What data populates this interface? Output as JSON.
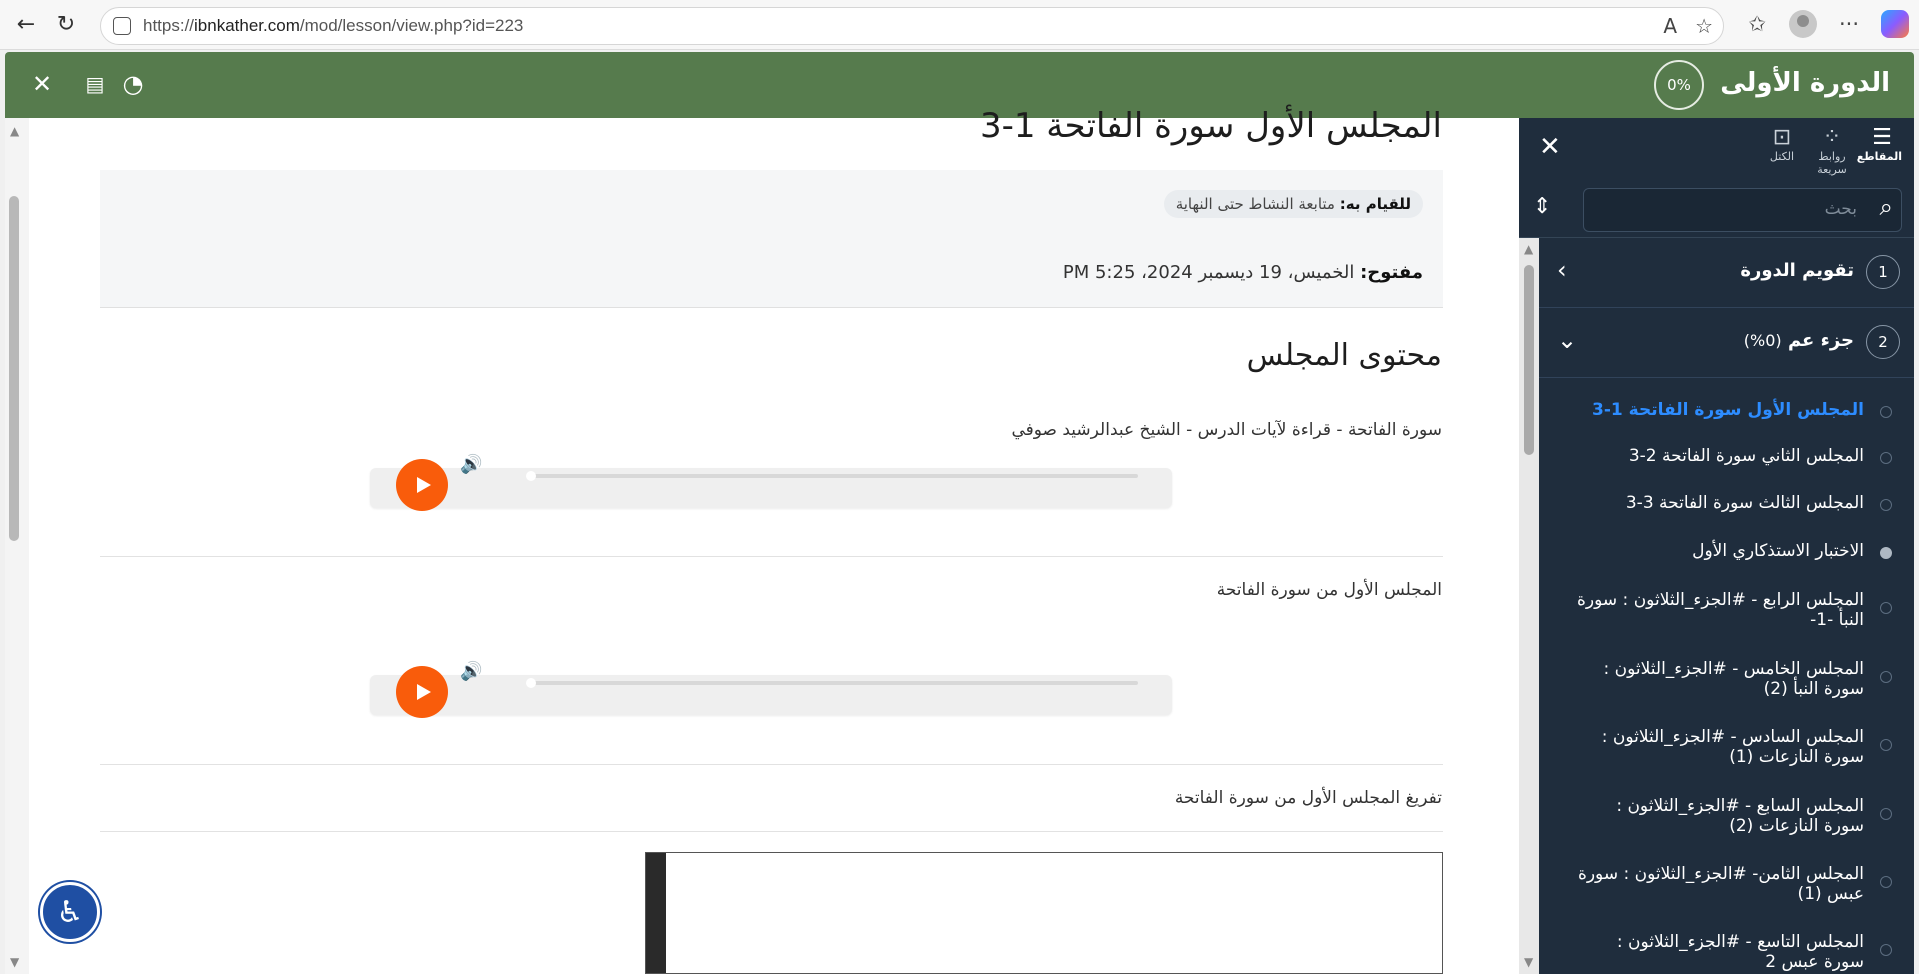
{
  "browser": {
    "url_prefix": "https://",
    "url_domain": "ibnkather.com",
    "url_path": "/mod/lesson/view.php?id=223"
  },
  "course": {
    "title": "الدورة الأولى",
    "progress": "0%"
  },
  "page": {
    "title": "المجلس الأول سورة الفاتحة 1-3",
    "todo_label": "للقيام به:",
    "todo_value": "متابعة النشاط حتى النهاية",
    "opened_label": "مفتوح:",
    "opened_value": "الخميس، 19 ديسمبر 2024، 5:25 PM",
    "content_heading": "محتوى المجلس",
    "audio1_title": "سورة الفاتحة - قراءة لآيات الدرس - الشيخ عبدالرشيد صوفي",
    "audio2_title": "المجلس الأول من سورة الفاتحة",
    "transcript_title": "تفريغ المجلس الأول من سورة الفاتحة"
  },
  "drawer": {
    "tabs": [
      "المقاطع",
      "روابط سريعة",
      "الكتل"
    ],
    "search_placeholder": "بحث",
    "sections": [
      {
        "num": "1",
        "title": "تقويم الدورة",
        "progress": ""
      },
      {
        "num": "2",
        "title": "جزء عم",
        "progress": "(0%)"
      }
    ],
    "lessons": [
      {
        "label": "المجلس الأول سورة الفاتحة 1-3"
      },
      {
        "label": "المجلس الثاني سورة الفاتحة 2-3"
      },
      {
        "label": "المجلس الثالث سورة الفاتحة 3-3"
      },
      {
        "label": "الاختبار الاستذكاري الأول"
      },
      {
        "label": "المجلس الرابع - #الجزء_الثلاثون : سورة النبأ -1-"
      },
      {
        "label": "المجلس الخامس - #الجزء_الثلاثون : سورة النبأ (2)"
      },
      {
        "label": "المجلس السادس - #الجزء_الثلاثون : سورة النازعات (1)"
      },
      {
        "label": "المجلس السابع - #الجزء_الثلاثون : سورة النازعات (2)"
      },
      {
        "label": "المجلس الثامن- #الجزء_الثلاثون : سورة عبس (1)"
      },
      {
        "label": "المجلس التاسع - #الجزء_الثلاثون : سورة عبس 2"
      }
    ]
  },
  "icons": {
    "back": "arrow-left-icon",
    "reload": "reload-icon",
    "play": "play-icon",
    "volume": "volume-icon"
  },
  "colors": {
    "header_green": "#567b4d",
    "drawer_bg": "#1f2d3d",
    "play_orange": "#f95c0b",
    "current_lesson": "#2d8cff"
  }
}
